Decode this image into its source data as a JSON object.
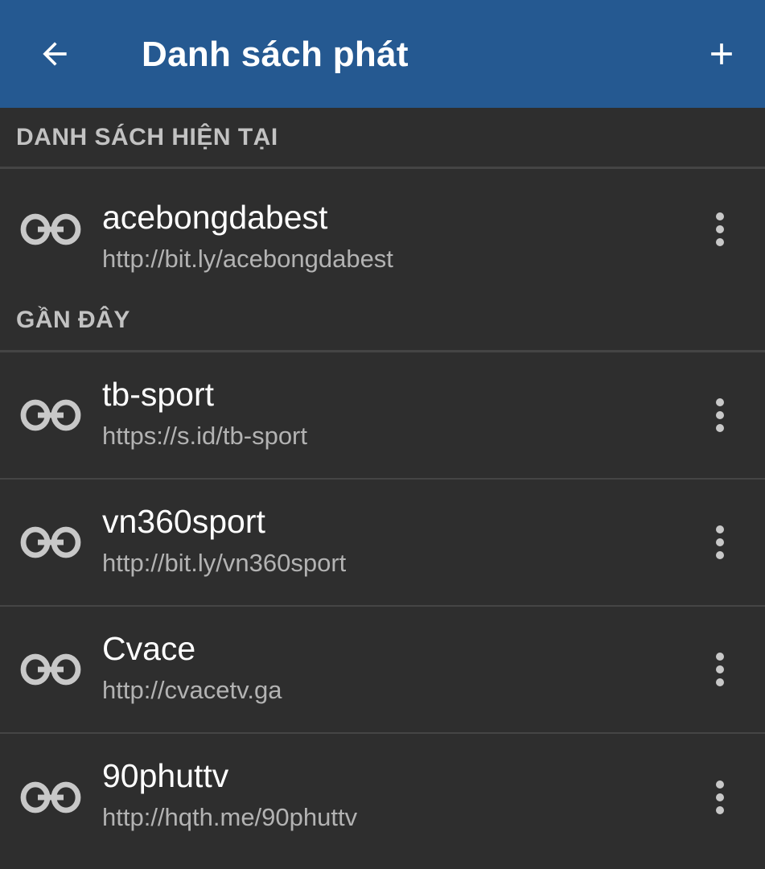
{
  "toolbar": {
    "title": "Danh sách phát",
    "back_icon": "arrow-left-icon",
    "add_icon": "plus-icon",
    "background": "#255991"
  },
  "sections": {
    "current": {
      "header": "DANH SÁCH HIỆN TẠI",
      "items": [
        {
          "name": "acebongdabest",
          "url": "http://bit.ly/acebongdabest"
        }
      ]
    },
    "recent": {
      "header": "GẦN ĐÂY",
      "items": [
        {
          "name": "tb-sport",
          "url": "https://s.id/tb-sport"
        },
        {
          "name": "vn360sport",
          "url": "http://bit.ly/vn360sport"
        },
        {
          "name": "Cvace",
          "url": "http://cvacetv.ga"
        },
        {
          "name": "90phuttv",
          "url": "http://hqth.me/90phuttv"
        }
      ]
    }
  },
  "icons": {
    "item_icon": "link-icon",
    "menu_icon": "more-vertical-icon"
  },
  "colors": {
    "background": "#2e2e2e",
    "divider": "#454545",
    "primary_text": "#ffffff",
    "secondary_text": "#b3b3b3",
    "header_text": "#c2c2c2"
  }
}
